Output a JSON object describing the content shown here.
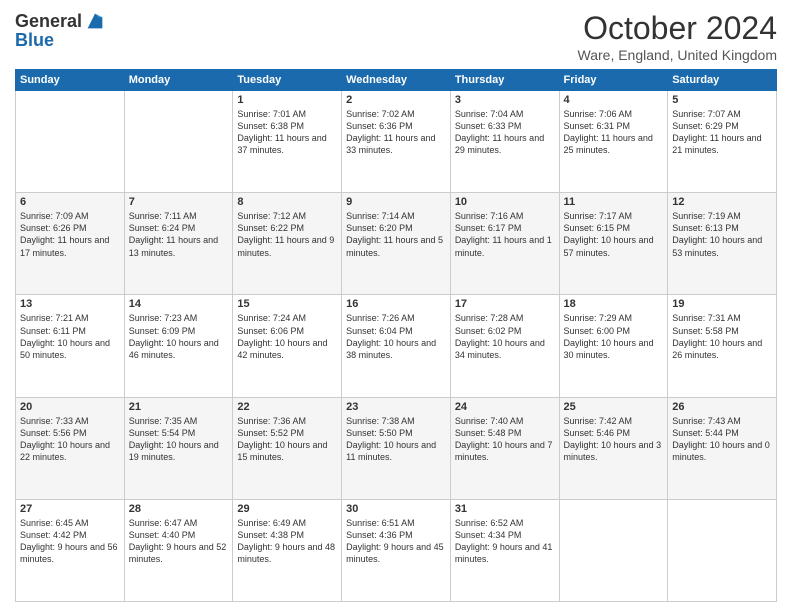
{
  "header": {
    "logo_general": "General",
    "logo_blue": "Blue",
    "month": "October 2024",
    "location": "Ware, England, United Kingdom"
  },
  "days_of_week": [
    "Sunday",
    "Monday",
    "Tuesday",
    "Wednesday",
    "Thursday",
    "Friday",
    "Saturday"
  ],
  "weeks": [
    [
      {
        "day": "",
        "info": ""
      },
      {
        "day": "",
        "info": ""
      },
      {
        "day": "1",
        "info": "Sunrise: 7:01 AM\nSunset: 6:38 PM\nDaylight: 11 hours and 37 minutes."
      },
      {
        "day": "2",
        "info": "Sunrise: 7:02 AM\nSunset: 6:36 PM\nDaylight: 11 hours and 33 minutes."
      },
      {
        "day": "3",
        "info": "Sunrise: 7:04 AM\nSunset: 6:33 PM\nDaylight: 11 hours and 29 minutes."
      },
      {
        "day": "4",
        "info": "Sunrise: 7:06 AM\nSunset: 6:31 PM\nDaylight: 11 hours and 25 minutes."
      },
      {
        "day": "5",
        "info": "Sunrise: 7:07 AM\nSunset: 6:29 PM\nDaylight: 11 hours and 21 minutes."
      }
    ],
    [
      {
        "day": "6",
        "info": "Sunrise: 7:09 AM\nSunset: 6:26 PM\nDaylight: 11 hours and 17 minutes."
      },
      {
        "day": "7",
        "info": "Sunrise: 7:11 AM\nSunset: 6:24 PM\nDaylight: 11 hours and 13 minutes."
      },
      {
        "day": "8",
        "info": "Sunrise: 7:12 AM\nSunset: 6:22 PM\nDaylight: 11 hours and 9 minutes."
      },
      {
        "day": "9",
        "info": "Sunrise: 7:14 AM\nSunset: 6:20 PM\nDaylight: 11 hours and 5 minutes."
      },
      {
        "day": "10",
        "info": "Sunrise: 7:16 AM\nSunset: 6:17 PM\nDaylight: 11 hours and 1 minute."
      },
      {
        "day": "11",
        "info": "Sunrise: 7:17 AM\nSunset: 6:15 PM\nDaylight: 10 hours and 57 minutes."
      },
      {
        "day": "12",
        "info": "Sunrise: 7:19 AM\nSunset: 6:13 PM\nDaylight: 10 hours and 53 minutes."
      }
    ],
    [
      {
        "day": "13",
        "info": "Sunrise: 7:21 AM\nSunset: 6:11 PM\nDaylight: 10 hours and 50 minutes."
      },
      {
        "day": "14",
        "info": "Sunrise: 7:23 AM\nSunset: 6:09 PM\nDaylight: 10 hours and 46 minutes."
      },
      {
        "day": "15",
        "info": "Sunrise: 7:24 AM\nSunset: 6:06 PM\nDaylight: 10 hours and 42 minutes."
      },
      {
        "day": "16",
        "info": "Sunrise: 7:26 AM\nSunset: 6:04 PM\nDaylight: 10 hours and 38 minutes."
      },
      {
        "day": "17",
        "info": "Sunrise: 7:28 AM\nSunset: 6:02 PM\nDaylight: 10 hours and 34 minutes."
      },
      {
        "day": "18",
        "info": "Sunrise: 7:29 AM\nSunset: 6:00 PM\nDaylight: 10 hours and 30 minutes."
      },
      {
        "day": "19",
        "info": "Sunrise: 7:31 AM\nSunset: 5:58 PM\nDaylight: 10 hours and 26 minutes."
      }
    ],
    [
      {
        "day": "20",
        "info": "Sunrise: 7:33 AM\nSunset: 5:56 PM\nDaylight: 10 hours and 22 minutes."
      },
      {
        "day": "21",
        "info": "Sunrise: 7:35 AM\nSunset: 5:54 PM\nDaylight: 10 hours and 19 minutes."
      },
      {
        "day": "22",
        "info": "Sunrise: 7:36 AM\nSunset: 5:52 PM\nDaylight: 10 hours and 15 minutes."
      },
      {
        "day": "23",
        "info": "Sunrise: 7:38 AM\nSunset: 5:50 PM\nDaylight: 10 hours and 11 minutes."
      },
      {
        "day": "24",
        "info": "Sunrise: 7:40 AM\nSunset: 5:48 PM\nDaylight: 10 hours and 7 minutes."
      },
      {
        "day": "25",
        "info": "Sunrise: 7:42 AM\nSunset: 5:46 PM\nDaylight: 10 hours and 3 minutes."
      },
      {
        "day": "26",
        "info": "Sunrise: 7:43 AM\nSunset: 5:44 PM\nDaylight: 10 hours and 0 minutes."
      }
    ],
    [
      {
        "day": "27",
        "info": "Sunrise: 6:45 AM\nSunset: 4:42 PM\nDaylight: 9 hours and 56 minutes."
      },
      {
        "day": "28",
        "info": "Sunrise: 6:47 AM\nSunset: 4:40 PM\nDaylight: 9 hours and 52 minutes."
      },
      {
        "day": "29",
        "info": "Sunrise: 6:49 AM\nSunset: 4:38 PM\nDaylight: 9 hours and 48 minutes."
      },
      {
        "day": "30",
        "info": "Sunrise: 6:51 AM\nSunset: 4:36 PM\nDaylight: 9 hours and 45 minutes."
      },
      {
        "day": "31",
        "info": "Sunrise: 6:52 AM\nSunset: 4:34 PM\nDaylight: 9 hours and 41 minutes."
      },
      {
        "day": "",
        "info": ""
      },
      {
        "day": "",
        "info": ""
      }
    ]
  ]
}
